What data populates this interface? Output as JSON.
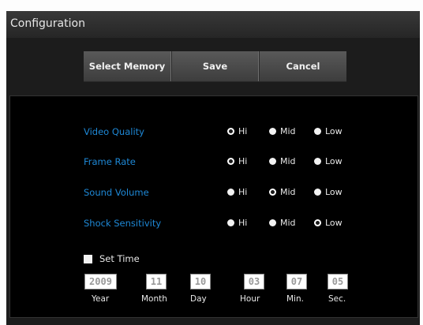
{
  "window": {
    "title": "Configuration"
  },
  "toolbar": {
    "select_memory": "Select Memory",
    "save": "Save",
    "cancel": "Cancel"
  },
  "settings": [
    {
      "label": "Video Quality",
      "options": [
        "Hi",
        "Mid",
        "Low"
      ],
      "selected": "Hi"
    },
    {
      "label": "Frame Rate",
      "options": [
        "Hi",
        "Mid",
        "Low"
      ],
      "selected": "Hi"
    },
    {
      "label": "Sound Volume",
      "options": [
        "Hi",
        "Mid",
        "Low"
      ],
      "selected": "Mid"
    },
    {
      "label": "Shock Sensitivity",
      "options": [
        "Hi",
        "Mid",
        "Low"
      ],
      "selected": "Low"
    }
  ],
  "set_time": {
    "label": "Set Time",
    "checked": false,
    "fields": [
      {
        "value": "2009",
        "label": "Year"
      },
      {
        "value": "11",
        "label": "Month"
      },
      {
        "value": "10",
        "label": "Day"
      },
      {
        "value": "03",
        "label": "Hour"
      },
      {
        "value": "07",
        "label": "Min."
      },
      {
        "value": "05",
        "label": "Sec."
      }
    ]
  },
  "colors": {
    "label_blue": "#1e88d6",
    "window_bg": "#1c1c1c",
    "panel_bg": "#000000"
  }
}
